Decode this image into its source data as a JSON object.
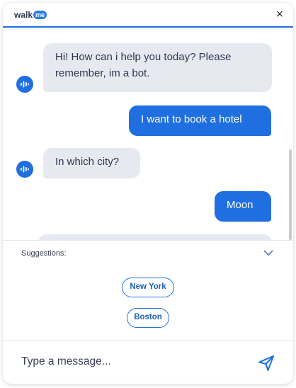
{
  "header": {
    "logo_text": "walk",
    "logo_badge": "me",
    "close_glyph": "×"
  },
  "messages": [
    {
      "sender": "bot",
      "lines": [
        "Hi! How can i help you today? Please",
        "remember, im a bot."
      ]
    },
    {
      "sender": "user",
      "text": "I want to book a hotel"
    },
    {
      "sender": "bot",
      "text": "In which city?"
    },
    {
      "sender": "user",
      "text": "Moon"
    }
  ],
  "suggestions": {
    "label": "Suggestions:",
    "items": [
      "New York",
      "Boston"
    ]
  },
  "composer": {
    "placeholder": "Type a message..."
  },
  "colors": {
    "accent": "#1f6fe0",
    "bot_bubble": "#e6eaf0",
    "text": "#2f3650"
  },
  "icons": {
    "bot_avatar": "waveform-icon",
    "send": "send-icon",
    "collapse": "chevron-down-icon",
    "close": "close-icon"
  }
}
